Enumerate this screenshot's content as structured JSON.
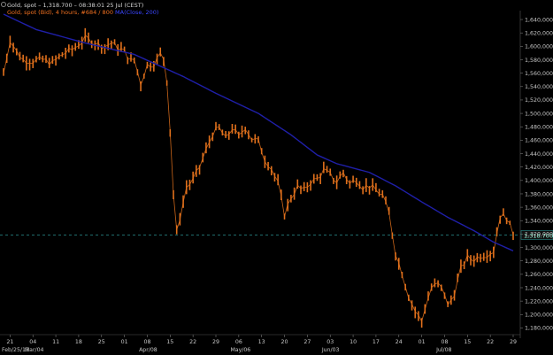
{
  "header": {
    "title_line": "Gold, spot – 1,318.700 – 08:38:01  25 Jul (CEST)",
    "series_line_gold": "Gold, spot (Bid), 4 hours, #684 / 800",
    "series_line_ma": "MA(Close, 200)"
  },
  "price_marker": "1,318.700",
  "colors": {
    "background": "#000000",
    "price": "#e0701c",
    "moving_average": "#1f1fa8",
    "price_line": "#2a8f8f",
    "axis_text": "#c8c8c8"
  },
  "chart_data": {
    "type": "line",
    "title": "Gold, spot",
    "ylim": [
      1170,
      1648
    ],
    "grid": false,
    "y_ticks": [
      "1,640,000",
      "1,620,000",
      "1,600,000",
      "1,580,000",
      "1,560,000",
      "1,540,000",
      "1,520,000",
      "1,500,000",
      "1,480,000",
      "1,460,000",
      "1,440,000",
      "1,420,000",
      "1,400,000",
      "1,380,000",
      "1,360,000",
      "1,340,000",
      "1,320,000",
      "1,300,000",
      "1,280,000",
      "1,260,000",
      "1,240,000",
      "1,220,000",
      "1,200,000",
      "1,180,000"
    ],
    "y_tick_values": [
      1640,
      1620,
      1600,
      1580,
      1560,
      1540,
      1520,
      1500,
      1480,
      1460,
      1440,
      1420,
      1400,
      1380,
      1360,
      1340,
      1320,
      1300,
      1280,
      1260,
      1240,
      1220,
      1200,
      1180
    ],
    "x_ticks": [
      "21",
      "04",
      "11",
      "18",
      "25",
      "01",
      "08",
      "15",
      "22",
      "29",
      "06",
      "13",
      "20",
      "27",
      "03",
      "10",
      "17",
      "24",
      "01",
      "08",
      "15",
      "22",
      "29"
    ],
    "x_tick_index": [
      2,
      9,
      16,
      23,
      30,
      37,
      44,
      51,
      58,
      65,
      72,
      79,
      86,
      93,
      100,
      107,
      114,
      121,
      128,
      135,
      142,
      149,
      156
    ],
    "x_month_labels": [
      {
        "label": "Feb/25/13",
        "index": 0
      },
      {
        "label": "Mar/04",
        "index": 7
      },
      {
        "label": "Apr/08",
        "index": 42
      },
      {
        "label": "May/06",
        "index": 70
      },
      {
        "label": "Jun/03",
        "index": 98
      },
      {
        "label": "Jul/08",
        "index": 133
      }
    ],
    "n_points": 156,
    "series": [
      {
        "key": "gold",
        "anchors": [
          [
            0,
            1560
          ],
          [
            2,
            1610
          ],
          [
            4,
            1592
          ],
          [
            6,
            1580
          ],
          [
            9,
            1578
          ],
          [
            12,
            1580
          ],
          [
            15,
            1575
          ],
          [
            18,
            1588
          ],
          [
            21,
            1595
          ],
          [
            23,
            1603
          ],
          [
            25,
            1612
          ],
          [
            27,
            1608
          ],
          [
            29,
            1603
          ],
          [
            31,
            1600
          ],
          [
            33,
            1605
          ],
          [
            35,
            1598
          ],
          [
            37,
            1592
          ],
          [
            39,
            1578
          ],
          [
            40,
            1580
          ],
          [
            42,
            1545
          ],
          [
            44,
            1572
          ],
          [
            46,
            1574
          ],
          [
            48,
            1588
          ],
          [
            49,
            1582
          ],
          [
            50,
            1550
          ],
          [
            51,
            1475
          ],
          [
            52,
            1380
          ],
          [
            53,
            1322
          ],
          [
            54,
            1345
          ],
          [
            56,
            1390
          ],
          [
            58,
            1400
          ],
          [
            60,
            1420
          ],
          [
            62,
            1445
          ],
          [
            64,
            1470
          ],
          [
            66,
            1478
          ],
          [
            68,
            1462
          ],
          [
            70,
            1478
          ],
          [
            72,
            1465
          ],
          [
            74,
            1480
          ],
          [
            76,
            1462
          ],
          [
            78,
            1458
          ],
          [
            80,
            1432
          ],
          [
            82,
            1418
          ],
          [
            84,
            1395
          ],
          [
            86,
            1350
          ],
          [
            88,
            1375
          ],
          [
            90,
            1390
          ],
          [
            92,
            1385
          ],
          [
            94,
            1398
          ],
          [
            96,
            1402
          ],
          [
            98,
            1415
          ],
          [
            100,
            1408
          ],
          [
            102,
            1398
          ],
          [
            104,
            1412
          ],
          [
            106,
            1395
          ],
          [
            108,
            1402
          ],
          [
            110,
            1390
          ],
          [
            112,
            1392
          ],
          [
            114,
            1385
          ],
          [
            116,
            1378
          ],
          [
            118,
            1350
          ],
          [
            120,
            1292
          ],
          [
            122,
            1262
          ],
          [
            124,
            1228
          ],
          [
            126,
            1205
          ],
          [
            128,
            1190
          ],
          [
            129,
            1210
          ],
          [
            131,
            1240
          ],
          [
            133,
            1245
          ],
          [
            135,
            1232
          ],
          [
            136,
            1212
          ],
          [
            138,
            1232
          ],
          [
            140,
            1268
          ],
          [
            142,
            1285
          ],
          [
            144,
            1282
          ],
          [
            146,
            1288
          ],
          [
            148,
            1290
          ],
          [
            150,
            1295
          ],
          [
            152,
            1348
          ],
          [
            154,
            1345
          ],
          [
            156,
            1318.7
          ]
        ]
      },
      {
        "key": "ma200",
        "anchors": [
          [
            0,
            1648
          ],
          [
            10,
            1625
          ],
          [
            25,
            1605
          ],
          [
            40,
            1588
          ],
          [
            55,
            1555
          ],
          [
            65,
            1530
          ],
          [
            78,
            1500
          ],
          [
            88,
            1468
          ],
          [
            96,
            1438
          ],
          [
            102,
            1425
          ],
          [
            112,
            1412
          ],
          [
            120,
            1392
          ],
          [
            128,
            1368
          ],
          [
            136,
            1345
          ],
          [
            144,
            1325
          ],
          [
            150,
            1308
          ],
          [
            156,
            1295
          ]
        ]
      }
    ]
  }
}
